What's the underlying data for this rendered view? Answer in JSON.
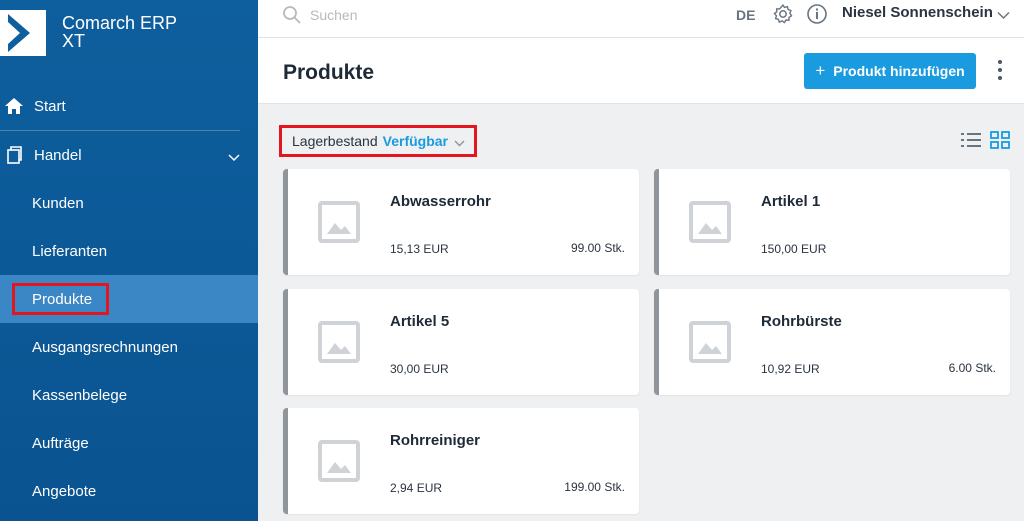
{
  "brand": {
    "name_line1": "Comarch ERP",
    "name_line2": "XT"
  },
  "sidebar": {
    "items": [
      {
        "label": "Start"
      },
      {
        "label": "Handel"
      },
      {
        "label": "Kunden"
      },
      {
        "label": "Lieferanten"
      },
      {
        "label": "Produkte"
      },
      {
        "label": "Ausgangsrechnungen"
      },
      {
        "label": "Kassenbelege"
      },
      {
        "label": "Aufträge"
      },
      {
        "label": "Angebote"
      }
    ]
  },
  "topbar": {
    "search_placeholder": "Suchen",
    "language": "DE",
    "user_name": "Niesel Sonnenschein"
  },
  "page": {
    "title": "Produkte",
    "add_button_label": "Produkt hinzufügen"
  },
  "filter": {
    "label": "Lagerbestand",
    "value": "Verfügbar"
  },
  "products": [
    {
      "name": "Abwasserrohr",
      "price": "15,13 EUR",
      "qty": "99.00 Stk."
    },
    {
      "name": "Artikel 1",
      "price": "150,00 EUR",
      "qty": ""
    },
    {
      "name": "Artikel 5",
      "price": "30,00 EUR",
      "qty": ""
    },
    {
      "name": "Rohrbürste",
      "price": "10,92 EUR",
      "qty": "6.00 Stk."
    },
    {
      "name": "Rohrreiniger",
      "price": "2,94 EUR",
      "qty": "199.00 Stk."
    }
  ],
  "colors": {
    "sidebar": "#0e5f9e",
    "accent": "#1a9be0",
    "highlight": "#e3161f",
    "active_item": "#3b86c4"
  }
}
